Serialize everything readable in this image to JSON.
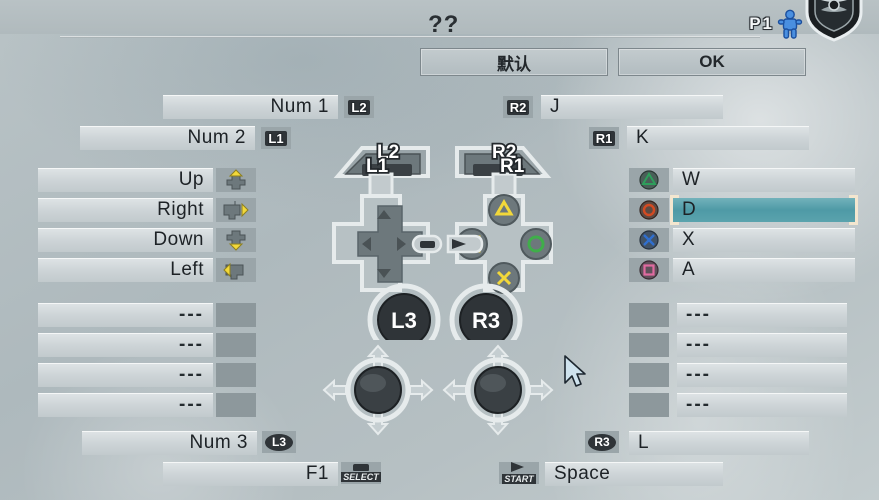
{
  "header": {
    "title": "??",
    "player_label": "P1",
    "player_icon": "player-figure-icon",
    "logo_icon": "shield-logo-icon"
  },
  "toolbar": {
    "default_label": "默认",
    "ok_label": "OK"
  },
  "bindings": {
    "left": [
      {
        "value": "Num 1",
        "badge": "L2",
        "badge_style": "square"
      },
      {
        "value": "Num 2",
        "badge": "L1",
        "badge_style": "square"
      },
      {
        "value": "Up",
        "badge": "dpad-up-icon",
        "badge_style": "icon"
      },
      {
        "value": "Right",
        "badge": "dpad-right-icon",
        "badge_style": "icon"
      },
      {
        "value": "Down",
        "badge": "dpad-down-icon",
        "badge_style": "icon"
      },
      {
        "value": "Left",
        "badge": "dpad-left-icon",
        "badge_style": "icon"
      },
      {
        "value": "---",
        "badge": "empty-icon",
        "badge_style": "empty"
      },
      {
        "value": "---",
        "badge": "empty-icon",
        "badge_style": "empty"
      },
      {
        "value": "---",
        "badge": "empty-icon",
        "badge_style": "empty"
      },
      {
        "value": "---",
        "badge": "empty-icon",
        "badge_style": "empty"
      },
      {
        "value": "Num 3",
        "badge": "L3",
        "badge_style": "oval"
      },
      {
        "value": "F1",
        "badge": "SELECT",
        "badge_style": "select"
      }
    ],
    "right": [
      {
        "badge": "R2",
        "badge_style": "square",
        "value": "J",
        "selected": false
      },
      {
        "badge": "R1",
        "badge_style": "square",
        "value": "K",
        "selected": false
      },
      {
        "badge": "triangle-button-icon",
        "badge_style": "icon",
        "value": "W",
        "selected": false
      },
      {
        "badge": "circle-button-icon",
        "badge_style": "icon",
        "value": "D",
        "selected": true
      },
      {
        "badge": "cross-button-icon",
        "badge_style": "icon",
        "value": "X",
        "selected": false
      },
      {
        "badge": "square-button-icon",
        "badge_style": "icon",
        "value": "A",
        "selected": false
      },
      {
        "badge": "empty-icon",
        "badge_style": "empty",
        "value": "---",
        "selected": false
      },
      {
        "badge": "empty-icon",
        "badge_style": "empty",
        "value": "---",
        "selected": false
      },
      {
        "badge": "empty-icon",
        "badge_style": "empty",
        "value": "---",
        "selected": false
      },
      {
        "badge": "empty-icon",
        "badge_style": "empty",
        "value": "---",
        "selected": false
      },
      {
        "badge": "R3",
        "badge_style": "oval",
        "value": "L",
        "selected": false
      },
      {
        "badge": "START",
        "badge_style": "start",
        "value": "Space",
        "selected": false
      }
    ]
  },
  "gamepad_diagram": {
    "shoulder_left_top": "L2",
    "shoulder_left_bottom": "L1",
    "shoulder_right_top": "R2",
    "shoulder_right_bottom": "R1",
    "stick_left": "L3",
    "stick_right": "R3",
    "select_glyph": "select-button-icon",
    "start_glyph": "start-button-icon",
    "face_buttons": [
      "triangle",
      "square",
      "circle",
      "cross"
    ]
  },
  "colors": {
    "selection_fill": "#4e9aa6",
    "selection_border": "#f3e6cf",
    "row_fill": "#d4dbde",
    "badge_bg": "#9aa5a9",
    "triangle": "#2e9e5b",
    "circle": "#d34a22",
    "cross": "#2f6fd0",
    "square": "#e06aa0",
    "accent_yellow": "#f2d83a"
  },
  "cursor": {
    "icon": "mouse-pointer-icon"
  }
}
